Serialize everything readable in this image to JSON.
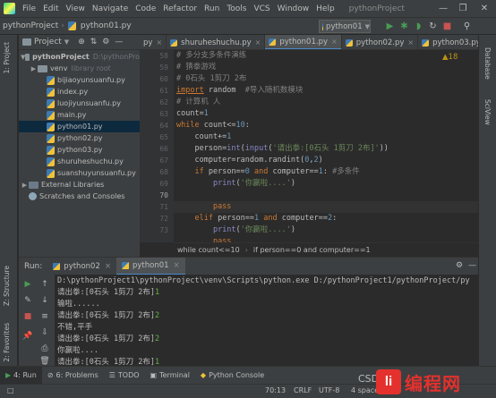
{
  "menubar": {
    "items": [
      "File",
      "Edit",
      "View",
      "Navigate",
      "Code",
      "Refactor",
      "Run",
      "Tools",
      "VCS",
      "Window",
      "Help"
    ],
    "window_title": "pythonProject",
    "minimize": "—",
    "maximize": "❐",
    "close": "✕"
  },
  "navbar": {
    "project": "pythonProject",
    "separator": "›",
    "file": "python01.py",
    "run_config": "python01"
  },
  "left_stripe": {
    "project": "1: Project",
    "structure": "Z: Structure",
    "favorites": "2: Favorites"
  },
  "right_stripe": {
    "database": "Database",
    "sciview": "SciView"
  },
  "project_panel": {
    "title": "Project",
    "tree": [
      {
        "label": "pythonProject",
        "dim": "D:\\pythonPro",
        "type": "folder",
        "depth": 0,
        "open": true
      },
      {
        "label": "venv",
        "dim": "library root",
        "type": "folder",
        "depth": 1,
        "open": false
      },
      {
        "label": "bijiaoyunsuanfu.py",
        "type": "py",
        "depth": 2
      },
      {
        "label": "index.py",
        "type": "py",
        "depth": 2
      },
      {
        "label": "luojiyunsuanfu.py",
        "type": "py",
        "depth": 2
      },
      {
        "label": "main.py",
        "type": "py",
        "depth": 2
      },
      {
        "label": "python01.py",
        "type": "py",
        "depth": 2,
        "selected": true
      },
      {
        "label": "python02.py",
        "type": "py",
        "depth": 2
      },
      {
        "label": "python03.py",
        "type": "py",
        "depth": 2
      },
      {
        "label": "shuruheshuchu.py",
        "type": "py",
        "depth": 2
      },
      {
        "label": "suanshuyunsuanfu.py",
        "type": "py",
        "depth": 2
      },
      {
        "label": "External Libraries",
        "type": "lib",
        "depth": 0,
        "open": false
      },
      {
        "label": "Scratches and Consoles",
        "type": "scratch",
        "depth": 0
      }
    ]
  },
  "editor_tabs": [
    {
      "label": "py",
      "active": false
    },
    {
      "label": "shuruheshuchu.py",
      "active": false
    },
    {
      "label": "python01.py",
      "active": true
    },
    {
      "label": "python02.py",
      "active": false
    },
    {
      "label": "python03.py",
      "active": false
    }
  ],
  "editor": {
    "warnings": "▲18",
    "line_numbers": [
      "58",
      "59",
      "60",
      "61",
      "62",
      "63",
      "64",
      "65",
      "66",
      "67",
      "68",
      "69",
      "70",
      "71",
      "72",
      "73"
    ],
    "current_line_index": 12
  },
  "code_breadcrumb": {
    "left": "while count<=10",
    "sep": "›",
    "right": "if person==0 and computer==1"
  },
  "run_panel": {
    "label": "Run:",
    "tabs": [
      {
        "label": "python02",
        "active": false
      },
      {
        "label": "python01",
        "active": true
      }
    ],
    "console": [
      {
        "text": "D:\\pythonProject1\\pythonProject\\venv\\Scripts\\python.exe D:/pythonProject1/pythonProject/py",
        "type": "out"
      },
      {
        "text": "请出拳:[0石头 1剪刀 2布]",
        "input": "1",
        "type": "prompt"
      },
      {
        "text": "输啦......",
        "type": "out"
      },
      {
        "text": "请出拳:[0石头 1剪刀 2布]",
        "input": "2",
        "type": "prompt"
      },
      {
        "text": "不错,平手",
        "type": "out"
      },
      {
        "text": "请出拳:[0石头 1剪刀 2布]",
        "input": "2",
        "type": "prompt"
      },
      {
        "text": "你嬴啦....",
        "type": "out"
      },
      {
        "text": "请出拳:[0石头 1剪刀 2布]",
        "input": "1",
        "type": "prompt"
      }
    ]
  },
  "bottom_tools": [
    {
      "label": "4: Run",
      "active": true
    },
    {
      "label": "6: Problems",
      "active": false
    },
    {
      "label": "TODO",
      "active": false
    },
    {
      "label": "Terminal",
      "active": false
    },
    {
      "label": "Python Console",
      "active": false
    }
  ],
  "statusbar": {
    "position": "70:13",
    "line_sep": "CRLF",
    "encoding": "UTF-8",
    "indent": "4 spaces",
    "csdn": "CSD"
  },
  "watermark": {
    "logo": "li",
    "text": "编程网"
  }
}
